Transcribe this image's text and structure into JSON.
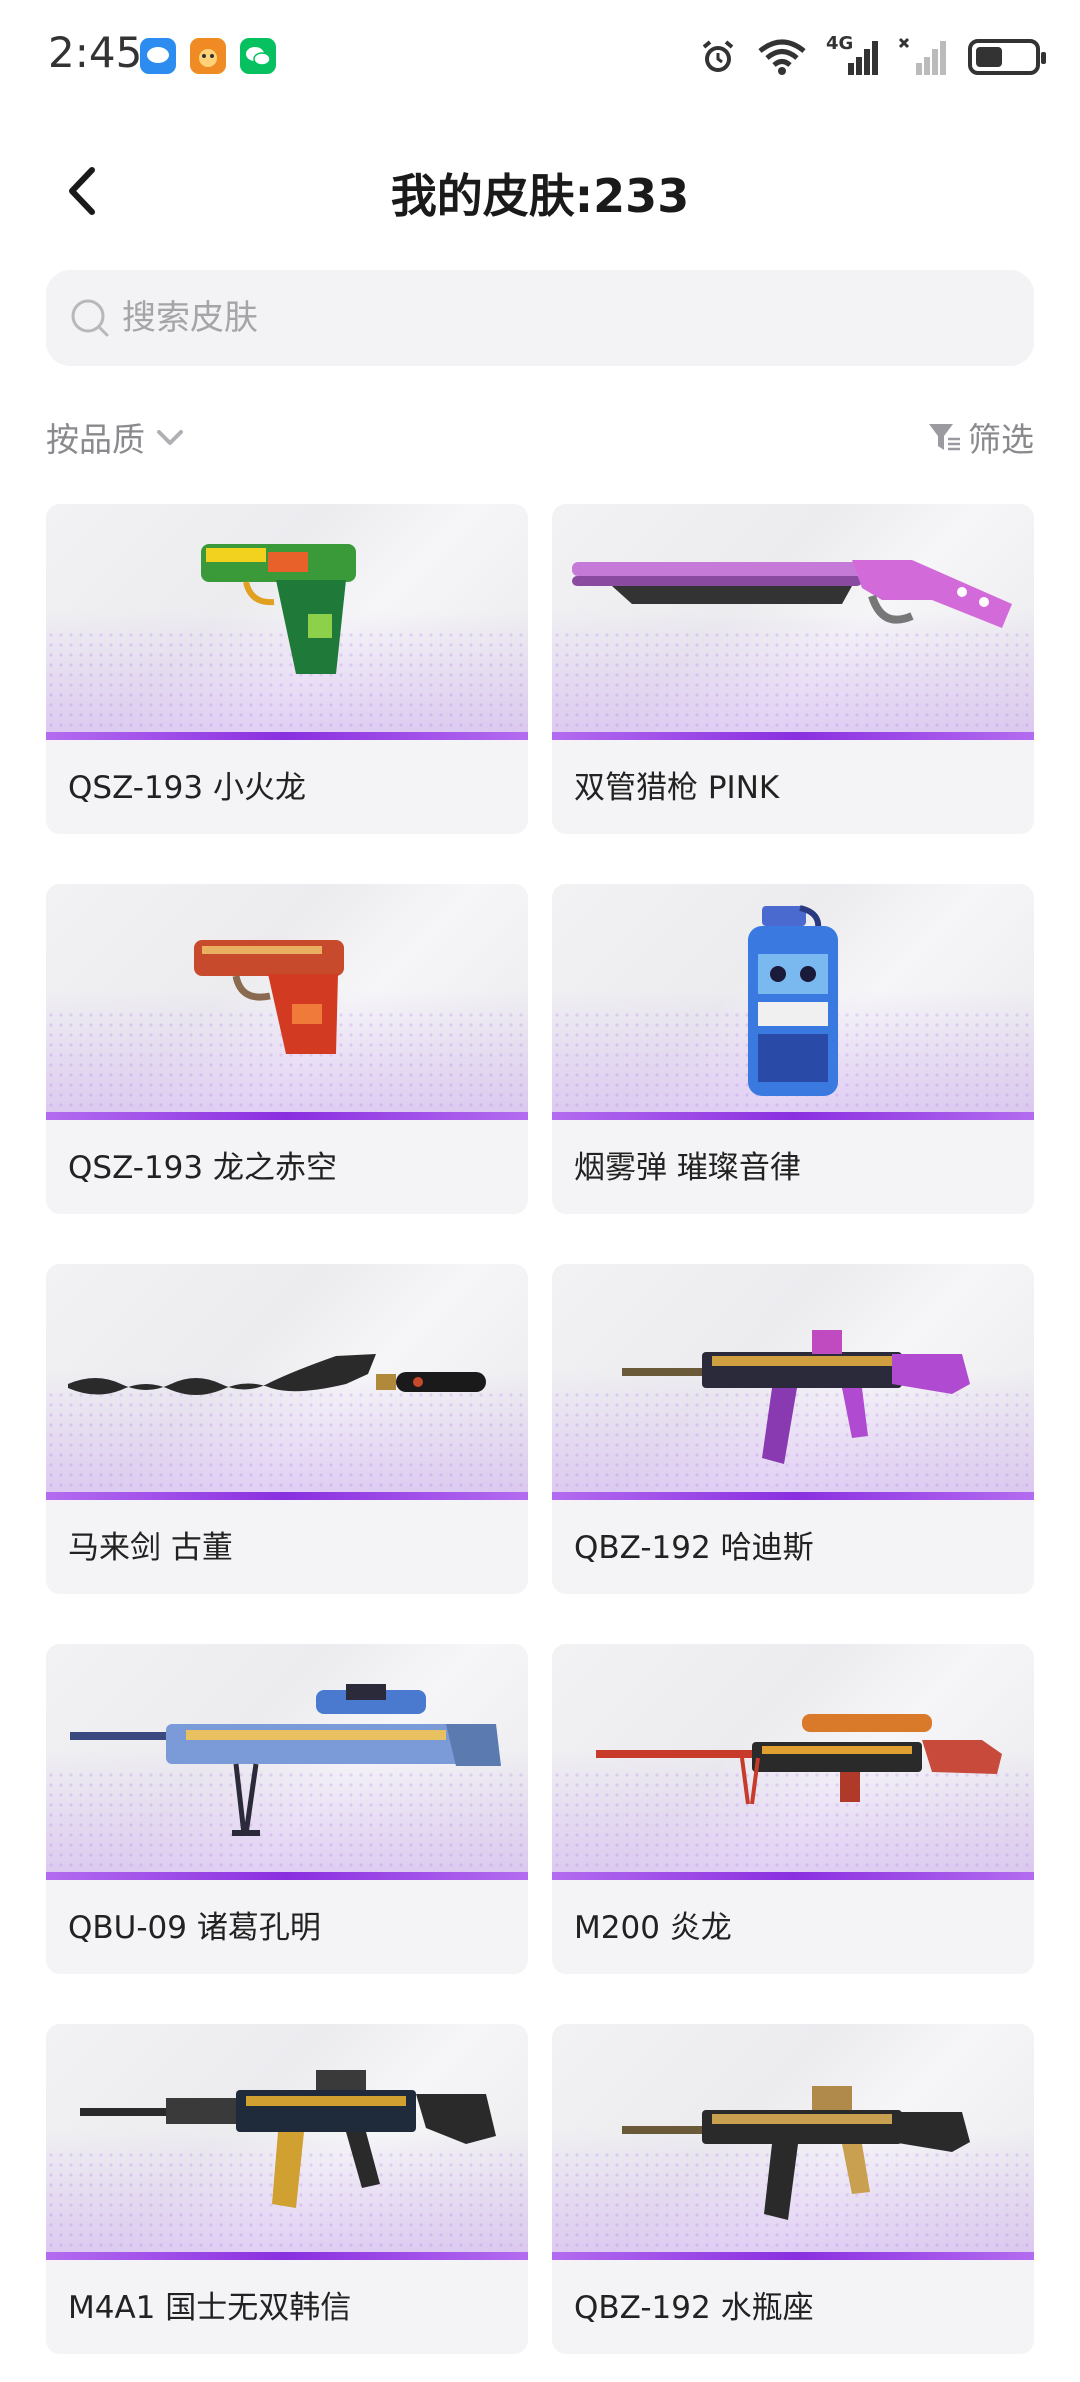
{
  "status_bar": {
    "time": "2:45",
    "network": "4G",
    "icons": [
      "message-app-icon",
      "game-app-icon",
      "wechat-icon",
      "alarm-icon",
      "wifi-icon",
      "signal-icon",
      "battery-icon"
    ]
  },
  "header": {
    "title": "我的皮肤:233"
  },
  "search": {
    "placeholder": "搜索皮肤",
    "value": ""
  },
  "toolbar": {
    "sort_label": "按品质",
    "filter_label": "筛选"
  },
  "skins": [
    {
      "name": "QSZ-193 小火龙"
    },
    {
      "name": "双管猎枪 PINK"
    },
    {
      "name": "QSZ-193 龙之赤空"
    },
    {
      "name": "烟雾弹 璀璨音律"
    },
    {
      "name": "马来剑 古董"
    },
    {
      "name": "QBZ-192 哈迪斯"
    },
    {
      "name": "QBU-09 诸葛孔明"
    },
    {
      "name": "M200 炎龙"
    },
    {
      "name": "M4A1 国士无双韩信"
    },
    {
      "name": "QBZ-192 水瓶座"
    }
  ],
  "colors": {
    "accent_purple": "#8a2fe0",
    "placeholder": "#a5a5a8"
  }
}
